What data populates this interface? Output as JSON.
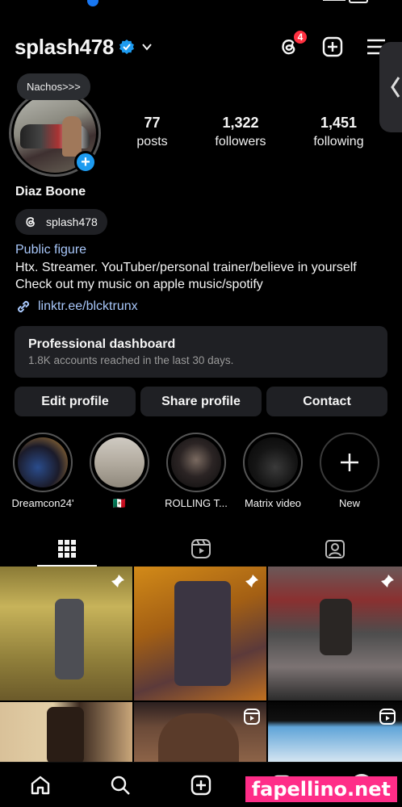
{
  "header": {
    "username": "splash478",
    "threads_badge": "4"
  },
  "note": "Nachos>>>",
  "stats": [
    {
      "value": "77",
      "label": "posts"
    },
    {
      "value": "1,322",
      "label": "followers"
    },
    {
      "value": "1,451",
      "label": "following"
    }
  ],
  "profile": {
    "name": "Diaz Boone",
    "threads_handle": "splash478",
    "category": "Public figure",
    "bio_line1": "Htx. Streamer. YouTuber/personal trainer/believe in yourself",
    "bio_line2": "Check out my music on apple music/spotify",
    "link": "linktr.ee/blcktrunx"
  },
  "dashboard": {
    "title": "Professional dashboard",
    "subtitle": "1.8K accounts reached in the last 30 days."
  },
  "buttons": {
    "edit": "Edit profile",
    "share": "Share profile",
    "contact": "Contact"
  },
  "highlights": [
    {
      "caption": "Dreamcon24'"
    },
    {
      "caption": "🇲🇽"
    },
    {
      "caption": "ROLLING T..."
    },
    {
      "caption": "Matrix video"
    },
    {
      "caption": "New"
    }
  ],
  "watermark": "fapellino.net",
  "colors": {
    "accent_blue": "#1d9bf0",
    "link_blue": "#a8c7fa",
    "badge_red": "#ff3040",
    "card_bg": "#1f2024"
  }
}
